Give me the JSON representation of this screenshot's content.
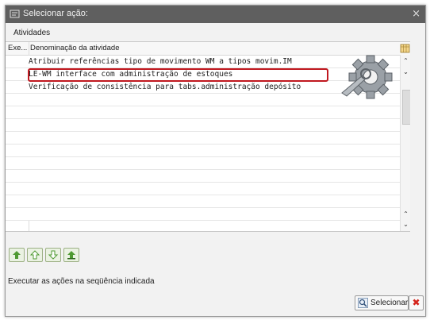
{
  "window": {
    "title": "Selecionar ação:",
    "close_glyph": "×"
  },
  "section_label": "Atividades",
  "table": {
    "columns": [
      "Exe...",
      "Denominação da atividade"
    ],
    "rows": [
      "Atribuir referências tipo de movimento WM a tipos movim.IM",
      "LE-WM interface com administração de estoques",
      "Verificação de consistência para tabs.administração depósito"
    ],
    "highlight_color": "#c0181f"
  },
  "scrollbar": {
    "up_glyph": "⌃",
    "down_glyph": "⌄"
  },
  "icons": {
    "title": "dialog-icon",
    "gear": "gear-wrench-icon",
    "grid": "table-settings-icon",
    "tools": [
      "execute-all-icon",
      "execute-selected-icon",
      "execute-down-icon",
      "execute-up-icon"
    ],
    "select": "magnifier-icon",
    "cancel": "cancel-icon"
  },
  "footer": {
    "info_text": "Executar as ações na seqüência indicada",
    "select_label": "Selecionar",
    "cancel_glyph": "✖"
  }
}
